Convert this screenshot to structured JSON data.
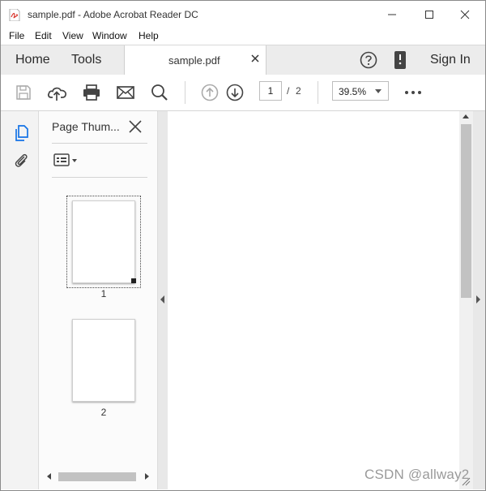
{
  "window": {
    "title": "sample.pdf - Adobe Acrobat Reader DC"
  },
  "menu": [
    "File",
    "Edit",
    "View",
    "Window",
    "Help"
  ],
  "tabs": {
    "home": "Home",
    "tools": "Tools",
    "document": "sample.pdf",
    "sign_in": "Sign In"
  },
  "toolbar": {
    "current_page": "1",
    "page_separator": "/",
    "total_pages": "2",
    "zoom": "39.5%"
  },
  "panel": {
    "title": "Page Thum...",
    "thumbnails": [
      {
        "label": "1",
        "selected": true
      },
      {
        "label": "2",
        "selected": false
      }
    ]
  },
  "watermark": "CSDN @allway2",
  "icons": {
    "app": "pdf-file-icon",
    "rail": [
      "page-thumbnails-icon",
      "attachments-icon"
    ],
    "toolbar": [
      "save-icon",
      "upload-cloud-icon",
      "print-icon",
      "email-icon",
      "search-icon",
      "previous-page-icon",
      "next-page-icon",
      "more-icon"
    ]
  },
  "colors": {
    "accent": "#1473e6",
    "pdf_red": "#d9352c",
    "tab_bar": "#ececec"
  }
}
